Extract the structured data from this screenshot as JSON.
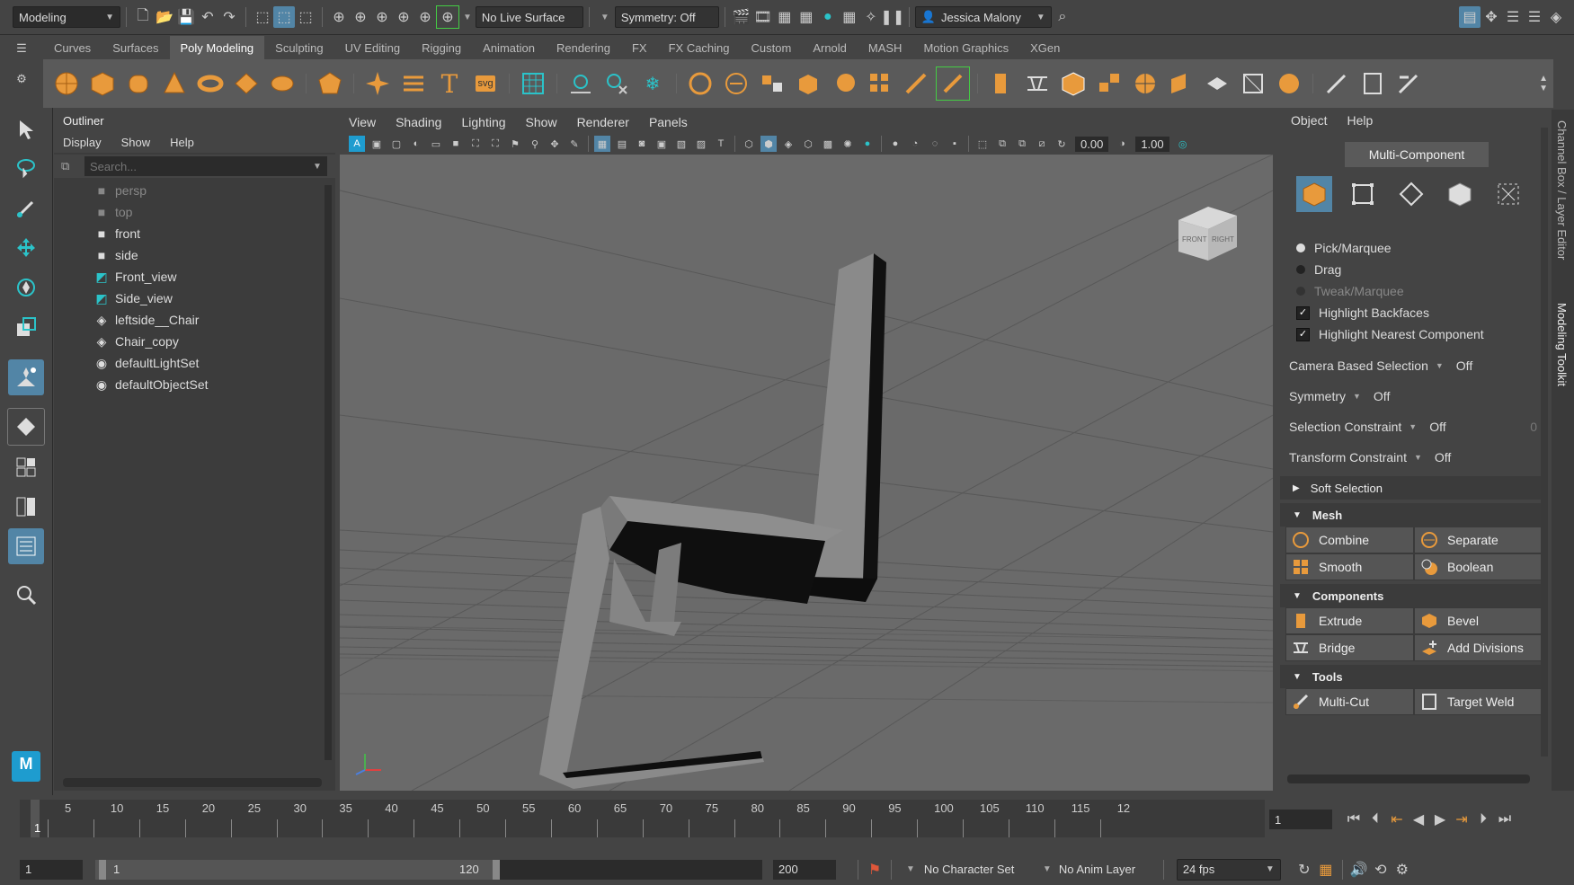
{
  "statusline": {
    "workspace": "Modeling",
    "live_surface": "No Live Surface",
    "symmetry": "Symmetry: Off",
    "user": "Jessica Malony"
  },
  "shelf_tabs": [
    "Curves",
    "Surfaces",
    "Poly Modeling",
    "Sculpting",
    "UV Editing",
    "Rigging",
    "Animation",
    "Rendering",
    "FX",
    "FX Caching",
    "Custom",
    "Arnold",
    "MASH",
    "Motion Graphics",
    "XGen"
  ],
  "shelf_active": "Poly Modeling",
  "outliner": {
    "title": "Outliner",
    "menu": [
      "Display",
      "Show",
      "Help"
    ],
    "search_placeholder": "Search...",
    "items": [
      {
        "label": "persp",
        "icon": "camera-icon",
        "dim": true
      },
      {
        "label": "top",
        "icon": "camera-icon",
        "dim": true
      },
      {
        "label": "front",
        "icon": "camera-icon",
        "dim": false
      },
      {
        "label": "side",
        "icon": "camera-icon",
        "dim": false
      },
      {
        "label": "Front_view",
        "icon": "image-plane-icon",
        "dim": false
      },
      {
        "label": "Side_view",
        "icon": "image-plane-icon",
        "dim": false
      },
      {
        "label": "leftside__Chair",
        "icon": "mesh-icon",
        "dim": false
      },
      {
        "label": "Chair_copy",
        "icon": "mesh-icon",
        "dim": false
      },
      {
        "label": "defaultLightSet",
        "icon": "set-icon",
        "dim": false
      },
      {
        "label": "defaultObjectSet",
        "icon": "set-icon",
        "dim": false
      }
    ]
  },
  "viewport": {
    "menu": [
      "View",
      "Shading",
      "Lighting",
      "Show",
      "Renderer",
      "Panels"
    ],
    "exposure": "0.00",
    "gamma": "1.00",
    "viewcube_front": "FRONT",
    "viewcube_right": "RIGHT"
  },
  "toolkit": {
    "menu": [
      "Object",
      "Help"
    ],
    "mode_button": "Multi-Component",
    "options": [
      {
        "label": "Pick/Marquee",
        "type": "radio",
        "dim": false
      },
      {
        "label": "Drag",
        "type": "radio",
        "dim": false
      },
      {
        "label": "Tweak/Marquee",
        "type": "radio",
        "dim": true
      },
      {
        "label": "Highlight Backfaces",
        "type": "check",
        "dim": false
      },
      {
        "label": "Highlight Nearest Component",
        "type": "check",
        "dim": false
      }
    ],
    "props": [
      {
        "label": "Camera Based Selection",
        "value": "Off"
      },
      {
        "label": "Symmetry",
        "value": "Off"
      },
      {
        "label": "Selection Constraint",
        "value": "Off",
        "extra": "0"
      },
      {
        "label": "Transform Constraint",
        "value": "Off"
      }
    ],
    "soft_selection": "Soft Selection",
    "mesh_title": "Mesh",
    "mesh_buttons": [
      "Combine",
      "Separate",
      "Smooth",
      "Boolean"
    ],
    "components_title": "Components",
    "components_buttons": [
      "Extrude",
      "Bevel",
      "Bridge",
      "Add Divisions"
    ],
    "tools_title": "Tools",
    "tools_buttons": [
      "Multi-Cut",
      "Target Weld"
    ]
  },
  "right_tabs": [
    "Channel Box / Layer Editor",
    "Modeling Toolkit"
  ],
  "timeline": {
    "ticks": [
      "5",
      "10",
      "15",
      "20",
      "25",
      "30",
      "35",
      "40",
      "45",
      "50",
      "55",
      "60",
      "65",
      "70",
      "75",
      "80",
      "85",
      "90",
      "95",
      "100",
      "105",
      "110",
      "115",
      "12"
    ],
    "current_frame_marker": "1",
    "current_frame": "1"
  },
  "range": {
    "start": "1",
    "range_start": "1",
    "range_end": "120",
    "end": "200",
    "character_set": "No Character Set",
    "anim_layer": "No Anim Layer",
    "fps": "24 fps"
  },
  "colors": {
    "accent": "#5285a6",
    "orange": "#e89a3c",
    "panel": "#444444"
  }
}
